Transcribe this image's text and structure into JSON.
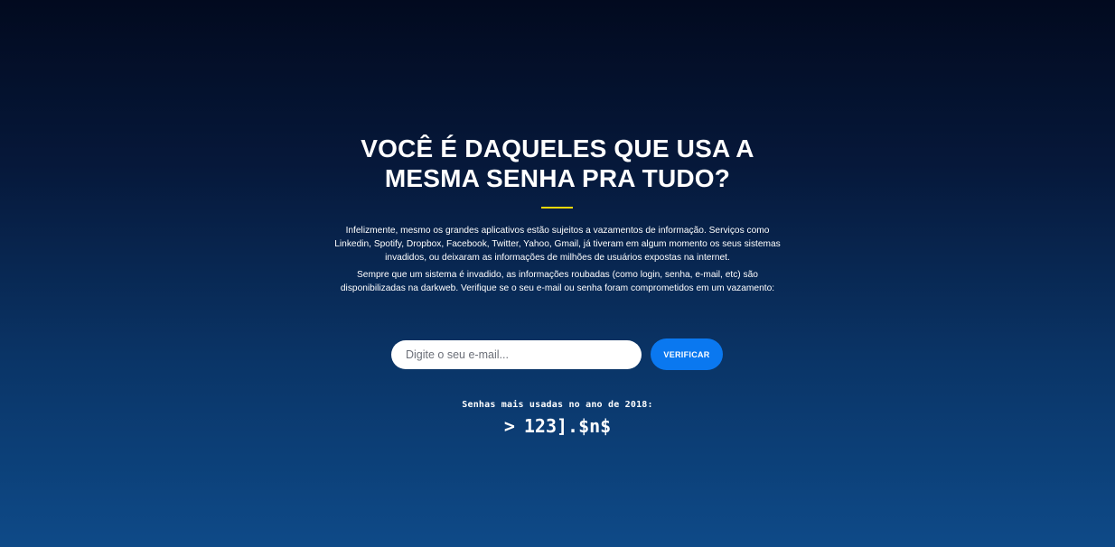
{
  "hero": {
    "title_line1": "VOCÊ É DAQUELES QUE USA A",
    "title_line2": "MESMA SENHA PRA TUDO?",
    "accent_color": "#f5d90a",
    "paragraph1": "Infelizmente, mesmo os grandes aplicativos estão sujeitos a vazamentos de informação. Serviços como Linkedin, Spotify, Dropbox, Facebook, Twitter, Yahoo, Gmail, já tiveram em algum momento os seus sistemas invadidos, ou deixaram as informações de milhões de usuários expostas na internet.",
    "paragraph2": "Sempre que um sistema é invadido, as informações roubadas (como login, senha, e-mail, etc) são disponibilizadas na darkweb. Verifique se o seu e-mail ou senha foram comprometidos em um vazamento:"
  },
  "search": {
    "email_value": "",
    "email_placeholder": "Digite o seu e-mail...",
    "button_label": "VERIFICAR",
    "button_color": "#0a78f0"
  },
  "top_passwords": {
    "label": "Senhas mais usadas no ano de 2018:",
    "prompt": ">",
    "current_password": "123].$n$"
  }
}
